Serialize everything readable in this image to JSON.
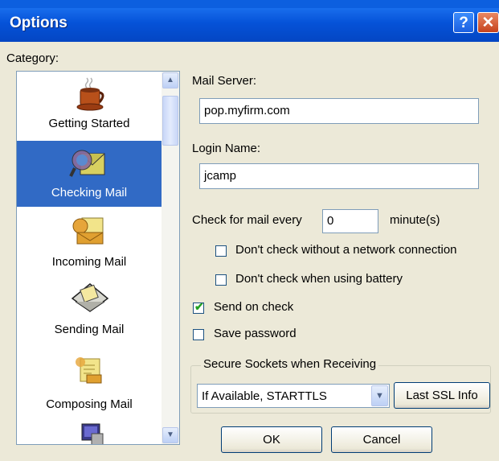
{
  "window": {
    "title": "Options",
    "help_label": "?",
    "close_label": "✕"
  },
  "category": {
    "label": "Category:",
    "items": [
      {
        "label": "Getting Started",
        "icon": "coffee-cup-icon",
        "selected": false
      },
      {
        "label": "Checking Mail",
        "icon": "checking-mail-icon",
        "selected": true
      },
      {
        "label": "Incoming Mail",
        "icon": "incoming-mail-icon",
        "selected": false
      },
      {
        "label": "Sending Mail",
        "icon": "sending-mail-icon",
        "selected": false
      },
      {
        "label": "Composing Mail",
        "icon": "composing-mail-icon",
        "selected": false
      },
      {
        "label": "",
        "icon": "computer-icon",
        "selected": false
      }
    ]
  },
  "mail_server": {
    "label": "Mail Server:",
    "value": "pop.myfirm.com"
  },
  "login_name": {
    "label": "Login Name:",
    "value": "jcamp"
  },
  "check_every": {
    "label": "Check for mail every",
    "value": "0",
    "unit": "minute(s)"
  },
  "options": [
    {
      "label": "Don't check without a network connection",
      "checked": false
    },
    {
      "label": "Don't check when using battery",
      "checked": false
    },
    {
      "label": "Send on check",
      "checked": true
    },
    {
      "label": "Save password",
      "checked": false
    }
  ],
  "ssl": {
    "group_label": "Secure Sockets when Receiving",
    "selected": "If Available, STARTTLS",
    "info_button": "Last SSL Info"
  },
  "buttons": {
    "ok": "OK",
    "cancel": "Cancel"
  },
  "colors": {
    "titlebar": "#0552d8",
    "selection": "#316ac5",
    "face": "#ece9d8"
  }
}
